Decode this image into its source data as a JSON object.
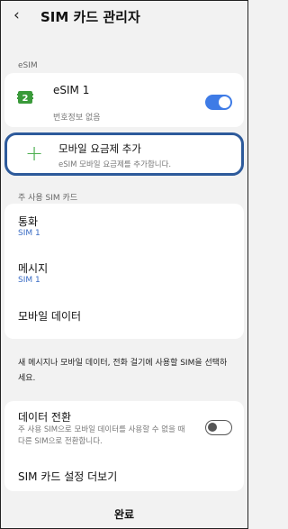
{
  "header": {
    "back_glyph": "‹",
    "title": "SIM 카드 관리자"
  },
  "esim_section": {
    "label": "eSIM",
    "esim": {
      "name": "eSIM 1",
      "number_info": "번호정보 없음",
      "badge": "2",
      "enabled": true
    }
  },
  "add_plan": {
    "title": "모바일 요금제 추가",
    "subtitle": "eSIM 모바일 요금제를 추가합니다.",
    "accent": "#2d5a9b",
    "plus_color": "#4caf50"
  },
  "preferred_section": {
    "label": "주 사용 SIM 카드",
    "rows": [
      {
        "title": "통화",
        "value": "SIM 1"
      },
      {
        "title": "메시지",
        "value": "SIM 1"
      },
      {
        "title": "모바일 데이터",
        "value": ""
      }
    ]
  },
  "note": "새 메시지나 모바일 데이터, 전화 걸기에 사용할 SIM을 선택하세요.",
  "data_switch": {
    "title": "데이터 전환",
    "description": "주 사용 SIM으로 모바일 데이터를 사용할 수 없을 때 다른 SIM으로 전환합니다.",
    "enabled": false
  },
  "more_settings": "SIM 카드 설정 더보기",
  "done": "완료",
  "colors": {
    "background": "#f2f2f2",
    "toggle_on": "#3e7be6",
    "link": "#3a6cc4"
  }
}
